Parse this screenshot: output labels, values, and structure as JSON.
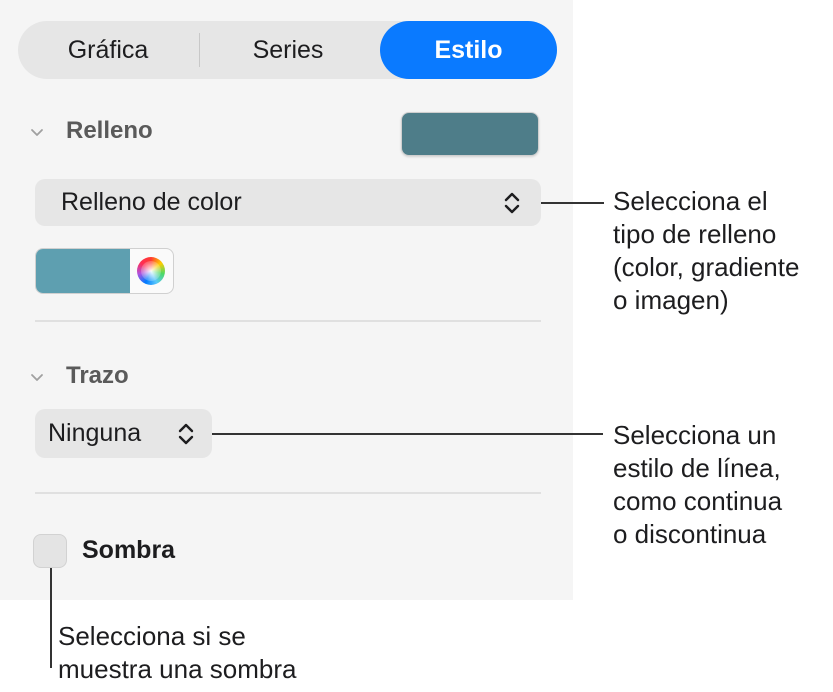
{
  "tabs": [
    {
      "label": "Gráfica",
      "selected": false
    },
    {
      "label": "Series",
      "selected": false
    },
    {
      "label": "Estilo",
      "selected": true
    }
  ],
  "fill_section": {
    "title": "Relleno",
    "swatch_color": "#4e7d89",
    "type_popup": "Relleno de color",
    "well_color": "#5e9fb0"
  },
  "stroke_section": {
    "title": "Trazo",
    "style_popup": "Ninguna"
  },
  "shadow": {
    "label": "Sombra",
    "checked": false
  },
  "callouts": {
    "fill_type": [
      "Selecciona el",
      "tipo de relleno",
      "(color, gradiente",
      "o imagen)"
    ],
    "stroke_style": [
      "Selecciona un",
      "estilo de línea,",
      "como continua",
      "o discontinua"
    ],
    "shadow": [
      "Selecciona si se",
      "muestra una sombra"
    ]
  },
  "colors": {
    "accent": "#0a7aff",
    "panel_bg": "#f5f5f5",
    "control_bg": "#e6e6e6"
  }
}
